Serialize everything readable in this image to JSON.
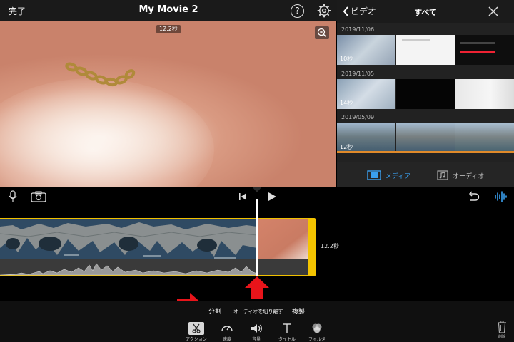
{
  "topbar": {
    "done_label": "完了",
    "title": "My Movie 2",
    "help_label": "?"
  },
  "viewer": {
    "duration": "12.2秒"
  },
  "browser": {
    "back_label": "ビデオ",
    "title": "すべて",
    "sections": [
      {
        "date": "2019/11/06",
        "first_duration": "10秒"
      },
      {
        "date": "2019/11/05",
        "first_duration": "14秒"
      },
      {
        "date": "2019/05/09",
        "first_duration": "12秒"
      }
    ],
    "tabs": {
      "media_label": "メディア",
      "audio_label": "オーディオ"
    }
  },
  "timeline": {
    "clip_duration": "12.2秒"
  },
  "actions": {
    "split_label": "分割",
    "detach_audio_label": "オーディオを切り離す",
    "duplicate_label": "複製"
  },
  "tools": {
    "action_label": "アクション",
    "speed_label": "速度",
    "volume_label": "音量",
    "title_label": "タイトル",
    "filter_label": "フィルタ",
    "delete_label": "削除"
  },
  "colors": {
    "accent": "#3aa0f0",
    "clip_border": "#f4c400",
    "annotation": "#e8141a"
  }
}
